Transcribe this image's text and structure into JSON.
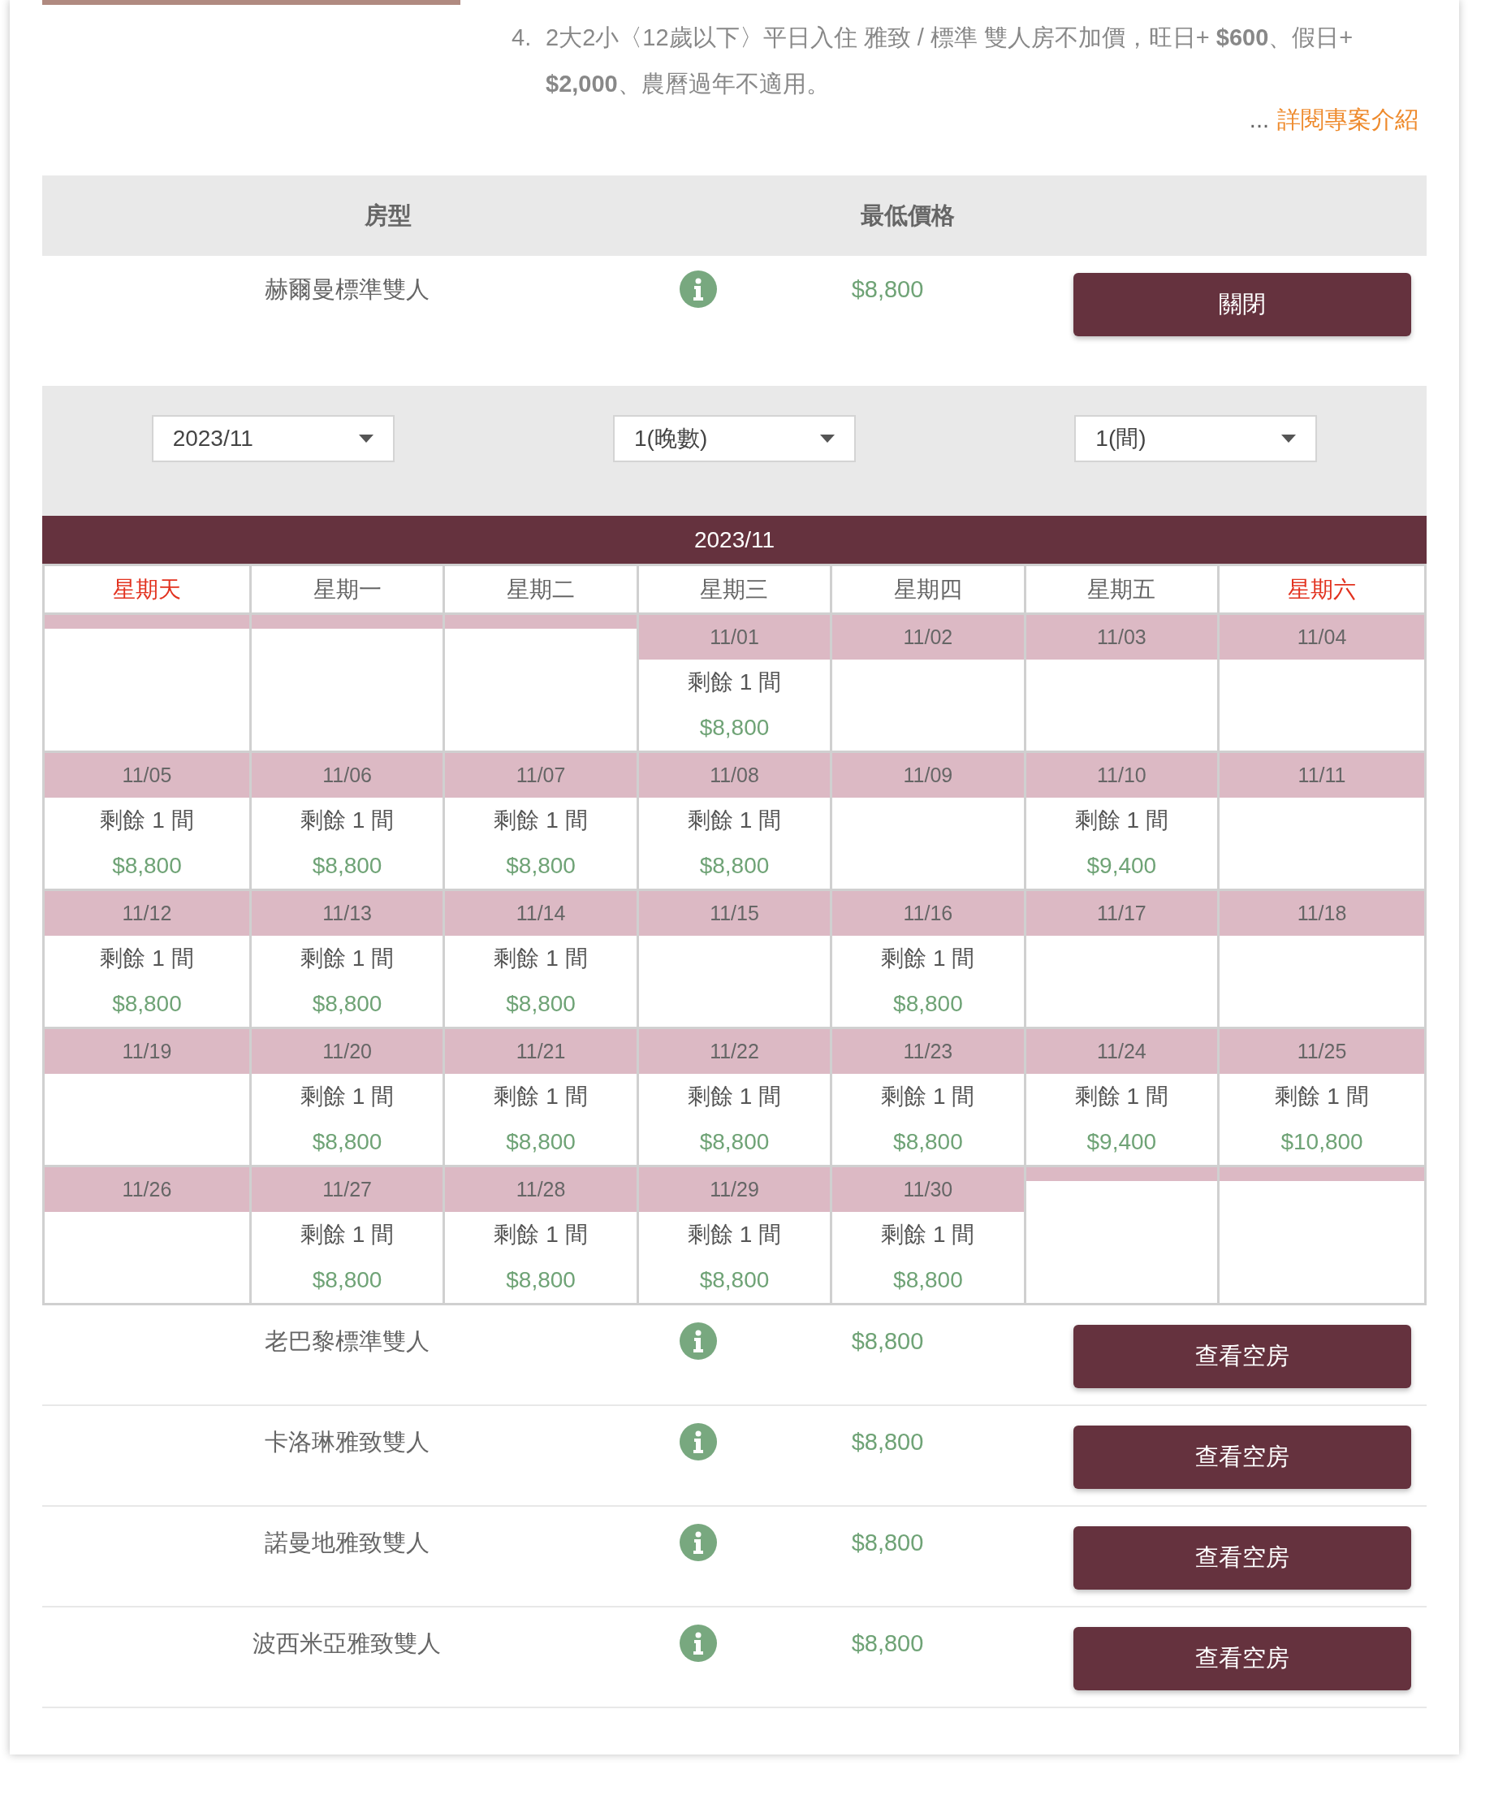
{
  "promo": {
    "lines": [
      {
        "number": "4.",
        "text": "2大2小〈12歲以下〉平日入住 雅致 / 標準 雙人房不加價，旺日+ **$600**、假日+ **$2,000**、農曆過年不適用。"
      }
    ],
    "more_link": {
      "ellipsis": "...",
      "label": "詳閱專案介紹"
    }
  },
  "table": {
    "columns": [
      "房型",
      "最低價格"
    ],
    "rows": [
      {
        "name": "赫爾曼標準雙人",
        "price": "$8,800",
        "button": "關閉",
        "expanded": true,
        "availability": {
          "selects": [
            {
              "value": "2023/11"
            },
            {
              "value": "1(晚數)"
            },
            {
              "value": "1(間)"
            }
          ],
          "calendar": {
            "title": "2023/11",
            "weekdays": [
              {
                "label": "星期天",
                "weekend": true
              },
              {
                "label": "星期一",
                "weekend": false
              },
              {
                "label": "星期二",
                "weekend": false
              },
              {
                "label": "星期三",
                "weekend": false
              },
              {
                "label": "星期四",
                "weekend": false
              },
              {
                "label": "星期五",
                "weekend": false
              },
              {
                "label": "星期六",
                "weekend": true
              }
            ],
            "weeks": [
              [
                {
                  "kind": "blank"
                },
                {
                  "kind": "blank"
                },
                {
                  "kind": "blank"
                },
                {
                  "date": "11/01",
                  "remaining": "剩餘 1 間",
                  "price": "$8,800"
                },
                {
                  "date": "11/02"
                },
                {
                  "date": "11/03"
                },
                {
                  "date": "11/04"
                }
              ],
              [
                {
                  "date": "11/05",
                  "remaining": "剩餘 1 間",
                  "price": "$8,800"
                },
                {
                  "date": "11/06",
                  "remaining": "剩餘 1 間",
                  "price": "$8,800"
                },
                {
                  "date": "11/07",
                  "remaining": "剩餘 1 間",
                  "price": "$8,800"
                },
                {
                  "date": "11/08",
                  "remaining": "剩餘 1 間",
                  "price": "$8,800"
                },
                {
                  "date": "11/09"
                },
                {
                  "date": "11/10",
                  "remaining": "剩餘 1 間",
                  "price": "$9,400"
                },
                {
                  "date": "11/11"
                }
              ],
              [
                {
                  "date": "11/12",
                  "remaining": "剩餘 1 間",
                  "price": "$8,800"
                },
                {
                  "date": "11/13",
                  "remaining": "剩餘 1 間",
                  "price": "$8,800"
                },
                {
                  "date": "11/14",
                  "remaining": "剩餘 1 間",
                  "price": "$8,800"
                },
                {
                  "date": "11/15"
                },
                {
                  "date": "11/16",
                  "remaining": "剩餘 1 間",
                  "price": "$8,800"
                },
                {
                  "date": "11/17"
                },
                {
                  "date": "11/18"
                }
              ],
              [
                {
                  "date": "11/19"
                },
                {
                  "date": "11/20",
                  "remaining": "剩餘 1 間",
                  "price": "$8,800"
                },
                {
                  "date": "11/21",
                  "remaining": "剩餘 1 間",
                  "price": "$8,800"
                },
                {
                  "date": "11/22",
                  "remaining": "剩餘 1 間",
                  "price": "$8,800"
                },
                {
                  "date": "11/23",
                  "remaining": "剩餘 1 間",
                  "price": "$8,800"
                },
                {
                  "date": "11/24",
                  "remaining": "剩餘 1 間",
                  "price": "$9,400"
                },
                {
                  "date": "11/25",
                  "remaining": "剩餘 1 間",
                  "price": "$10,800"
                }
              ],
              [
                {
                  "date": "11/26"
                },
                {
                  "date": "11/27",
                  "remaining": "剩餘 1 間",
                  "price": "$8,800"
                },
                {
                  "date": "11/28",
                  "remaining": "剩餘 1 間",
                  "price": "$8,800"
                },
                {
                  "date": "11/29",
                  "remaining": "剩餘 1 間",
                  "price": "$8,800"
                },
                {
                  "date": "11/30",
                  "remaining": "剩餘 1 間",
                  "price": "$8,800"
                },
                {
                  "kind": "blank"
                },
                {
                  "kind": "blank"
                }
              ]
            ]
          }
        }
      },
      {
        "name": "老巴黎標準雙人",
        "price": "$8,800",
        "button": "查看空房",
        "expanded": false
      },
      {
        "name": "卡洛琳雅致雙人",
        "price": "$8,800",
        "button": "查看空房",
        "expanded": false
      },
      {
        "name": "諾曼地雅致雙人",
        "price": "$8,800",
        "button": "查看空房",
        "expanded": false
      },
      {
        "name": "波西米亞雅致雙人",
        "price": "$8,800",
        "button": "查看空房",
        "expanded": false
      }
    ]
  }
}
